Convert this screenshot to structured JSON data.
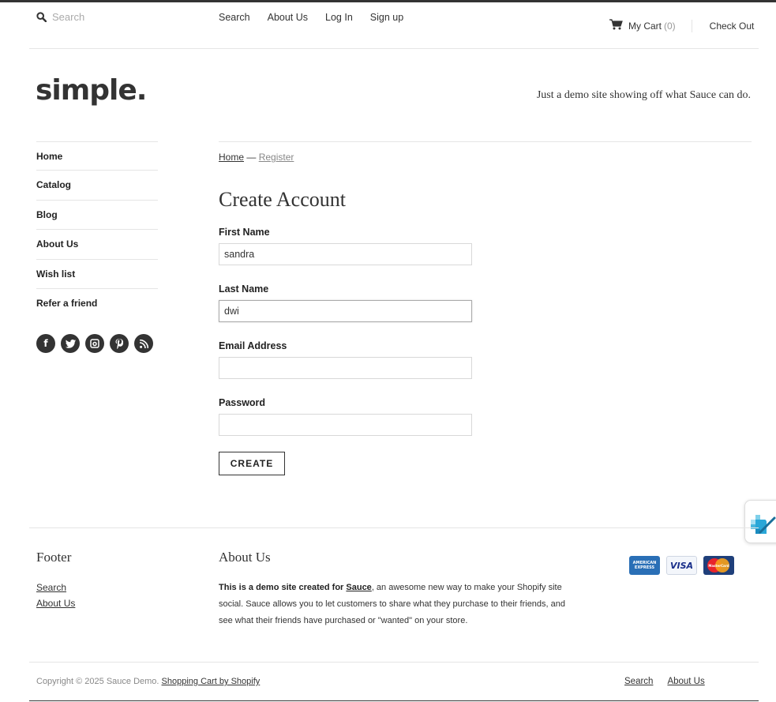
{
  "header": {
    "search_placeholder": "Search",
    "nav": [
      "Search",
      "About Us",
      "Log In",
      "Sign up"
    ],
    "cart_label": "My Cart",
    "cart_count": "(0)",
    "checkout_label": "Check Out"
  },
  "brand": {
    "logo": "simple.",
    "tagline": "Just a demo site showing off what Sauce can do."
  },
  "sidebar": {
    "items": [
      "Home",
      "Catalog",
      "Blog",
      "About Us",
      "Wish list",
      "Refer a friend"
    ],
    "social_icons": [
      "facebook-icon",
      "twitter-icon",
      "instagram-icon",
      "pinterest-icon",
      "rss-icon"
    ]
  },
  "breadcrumb": {
    "home": "Home",
    "separator": " — ",
    "current": "Register"
  },
  "form": {
    "title": "Create Account",
    "first_name_label": "First Name",
    "first_name_value": "sandra",
    "last_name_label": "Last Name",
    "last_name_value": "dwi",
    "email_label": "Email Address",
    "email_value": "",
    "password_label": "Password",
    "password_value": "",
    "submit_label": "CREATE"
  },
  "footer": {
    "heading": "Footer",
    "links": [
      "Search",
      "About Us"
    ],
    "about_heading": "About Us",
    "about_lead": "This is a demo site created for ",
    "about_link": "Sauce",
    "about_rest": ", an awesome new way to make your Shopify site social. Sauce allows you to let customers to share what they purchase to their friends, and see what their friends have purchased or \"wanted\" on your store.",
    "cards": [
      "AMERICAN EXPRESS",
      "VISA",
      "MasterCard"
    ],
    "copyright": "Copyright © 2025 Sauce Demo. ",
    "copyright_link": "Shopping Cart by Shopify",
    "bottom_links": [
      "Search",
      "About Us"
    ]
  },
  "colors": {
    "text": "#333333",
    "muted": "#888888",
    "border": "#e5e5e5"
  }
}
